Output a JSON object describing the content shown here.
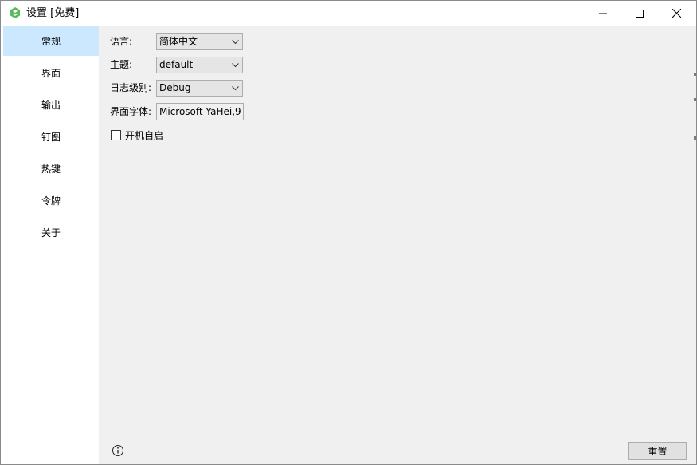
{
  "window": {
    "title": "设置 [免费]",
    "accent_color": "#cce8ff"
  },
  "sidebar": {
    "items": [
      {
        "label": "常规",
        "active": true
      },
      {
        "label": "界面",
        "active": false
      },
      {
        "label": "输出",
        "active": false
      },
      {
        "label": "钉图",
        "active": false
      },
      {
        "label": "热键",
        "active": false
      },
      {
        "label": "令牌",
        "active": false
      },
      {
        "label": "关于",
        "active": false
      }
    ]
  },
  "general": {
    "language": {
      "label": "语言:",
      "value": "简体中文"
    },
    "theme": {
      "label": "主题:",
      "value": "default"
    },
    "log_level": {
      "label": "日志级别:",
      "value": "Debug"
    },
    "ui_font": {
      "label": "界面字体:",
      "value": "Microsoft YaHei,9"
    },
    "autostart": {
      "label": "开机自启",
      "checked": false
    }
  },
  "footer": {
    "info_icon": "info-circle-icon",
    "reset_label": "重置"
  }
}
